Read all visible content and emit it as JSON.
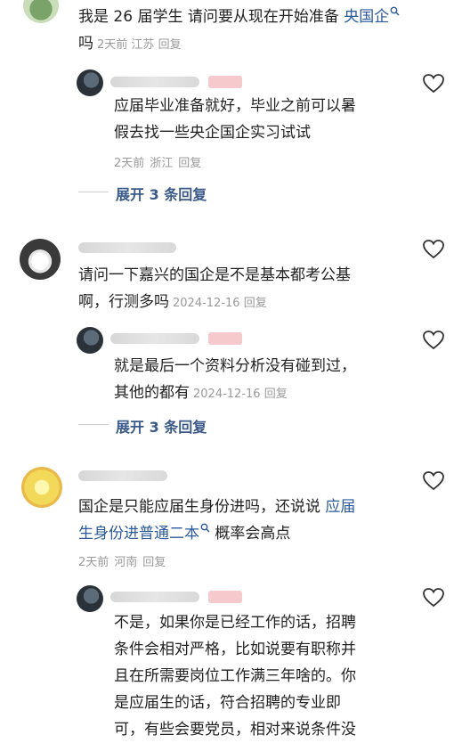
{
  "comments": [
    {
      "text": "我是 26 届学生 请问要从现在开始准备 ",
      "link": "央国企",
      "after_link": " 吗",
      "time": "2天前",
      "location": "江苏",
      "reply_label": "回复",
      "reply": {
        "text_line1": "应届毕业准备就好，毕业之前可以暑",
        "text_line2": "假去找一些央企国企实习试试",
        "time": "2天前",
        "location": "浙江",
        "reply_label": "回复"
      },
      "expand_label": "展开 3 条回复"
    },
    {
      "text_line1": "请问一下嘉兴的国企是不是基本都考公基",
      "text_line2": "啊，行测多吗",
      "time": "2024-12-16",
      "reply_label": "回复",
      "reply": {
        "text_line1": "就是最后一个资料分析没有碰到过，",
        "text_line2": "其他的都有",
        "time": "2024-12-16",
        "reply_label": "回复"
      },
      "expand_label": "展开 3 条回复"
    },
    {
      "text_line1_a": "国企是只能应届生身份进吗，还说说 ",
      "link_a": "应届",
      "link_b": "生身份进普通二本",
      "after_link": " 概率会高点",
      "time": "2天前",
      "location": "河南",
      "reply_label": "回复",
      "reply": {
        "line1": "不是，如果你是已经工作的话，招聘",
        "line2": "条件会相对严格，比如说要有职称并",
        "line3": "且在所需要岗位工作满三年啥的。你",
        "line4": "是应届生的话，符合招聘的专业即",
        "line5": "可，有些会要党员，相对来说条件没"
      }
    }
  ],
  "icons": {
    "like": "heart-icon",
    "search_link": "search-icon"
  }
}
